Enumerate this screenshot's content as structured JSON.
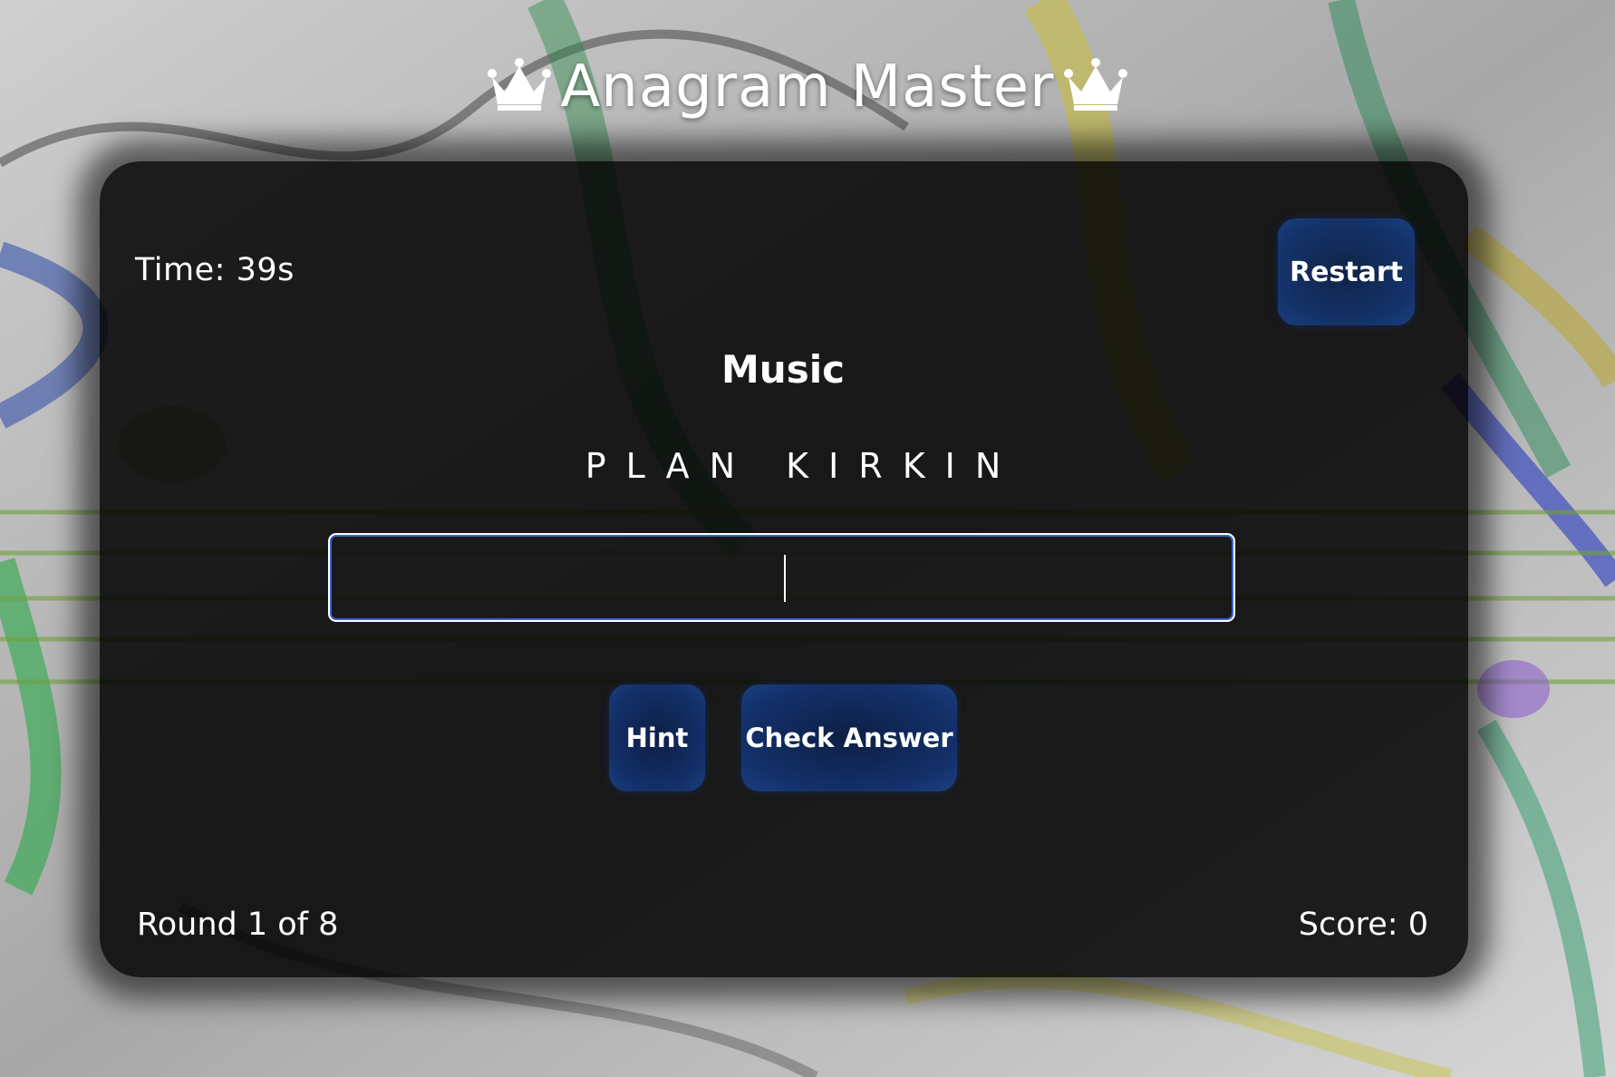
{
  "header": {
    "title": "Anagram Master"
  },
  "status": {
    "time": "Time: 39s",
    "round": "Round 1 of 8",
    "score": "Score: 0"
  },
  "controls": {
    "restart_label": "Restart",
    "hint_label": "Hint",
    "check_label": "Check Answer"
  },
  "puzzle": {
    "category": "Music",
    "scrambled": "PLAN KIRKIN",
    "answer_value": ""
  },
  "icons": {
    "left_crown": "crown-icon",
    "right_crown": "crown-icon"
  },
  "colors": {
    "button_bg": "#13306a",
    "input_border": "#3a63c9",
    "panel_bg": "#000000",
    "text": "#ffffff"
  }
}
